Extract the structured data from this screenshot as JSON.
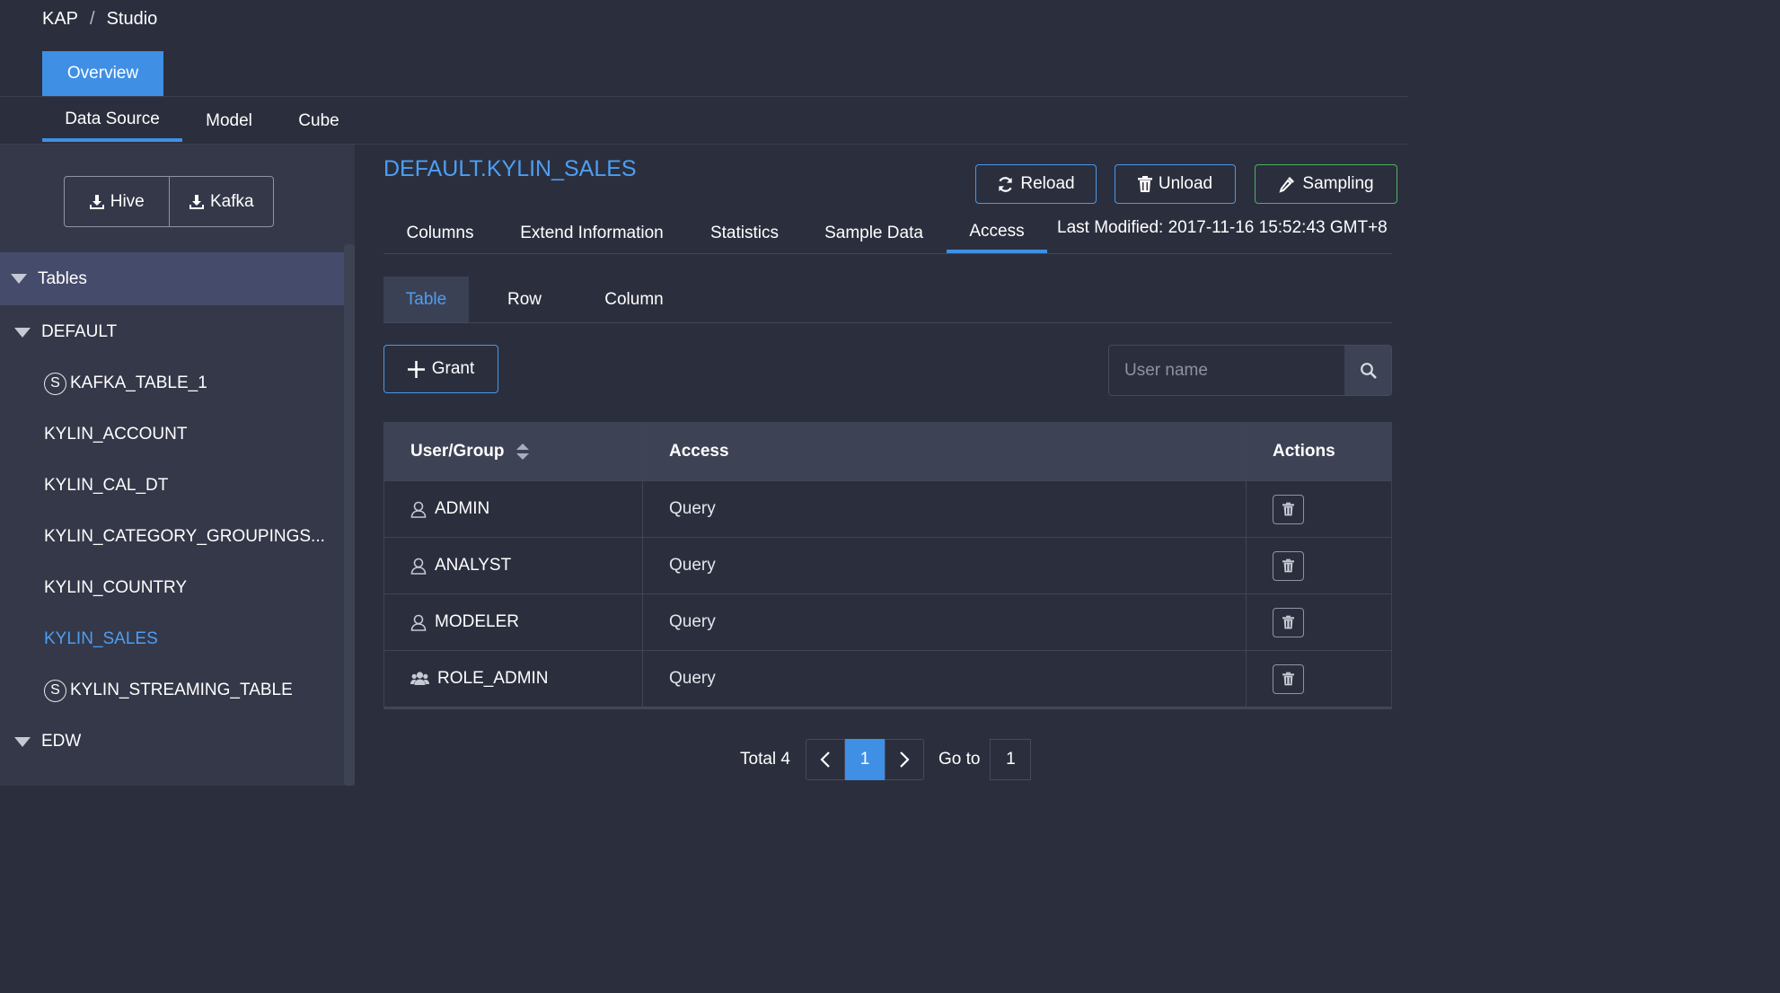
{
  "breadcrumb": {
    "root": "KAP",
    "separator": "/",
    "current": "Studio"
  },
  "overview_tab": "Overview",
  "subnav": {
    "items": [
      "Data Source",
      "Model",
      "Cube"
    ],
    "active": "Data Source"
  },
  "sidebar": {
    "import_buttons": {
      "hive": "Hive",
      "kafka": "Kafka"
    },
    "tables_header": "Tables",
    "databases": [
      {
        "name": "DEFAULT",
        "tables": [
          {
            "name": "KAFKA_TABLE_1",
            "streaming_badge": "S"
          },
          {
            "name": "KYLIN_ACCOUNT"
          },
          {
            "name": "KYLIN_CAL_DT"
          },
          {
            "name": "KYLIN_CATEGORY_GROUPINGS..."
          },
          {
            "name": "KYLIN_COUNTRY"
          },
          {
            "name": "KYLIN_SALES",
            "selected": true
          },
          {
            "name": "KYLIN_STREAMING_TABLE",
            "streaming_badge": "S"
          }
        ]
      },
      {
        "name": "EDW",
        "tables": []
      }
    ]
  },
  "main": {
    "table_title": "DEFAULT.KYLIN_SALES",
    "actions": {
      "reload": "Reload",
      "unload": "Unload",
      "sampling": "Sampling"
    },
    "tabs": [
      "Columns",
      "Extend Information",
      "Statistics",
      "Sample Data",
      "Access"
    ],
    "active_tab": "Access",
    "last_modified": "Last Modified: 2017-11-16 15:52:43 GMT+8",
    "access": {
      "tabs": [
        "Table",
        "Row",
        "Column"
      ],
      "active_tab": "Table",
      "grant_label": "Grant",
      "search_placeholder": "User name",
      "columns": {
        "user_group": "User/Group",
        "access": "Access",
        "actions": "Actions"
      },
      "rows": [
        {
          "name": "ADMIN",
          "type": "user",
          "access": "Query"
        },
        {
          "name": "ANALYST",
          "type": "user",
          "access": "Query"
        },
        {
          "name": "MODELER",
          "type": "user",
          "access": "Query"
        },
        {
          "name": "ROLE_ADMIN",
          "type": "group",
          "access": "Query"
        }
      ]
    },
    "pagination": {
      "total_label": "Total 4",
      "current_page": "1",
      "goto_label": "Go to",
      "goto_value": "1"
    }
  },
  "colors": {
    "accent": "#3f8fe5",
    "link": "#4d9ef2",
    "sampling_border": "#4fb061",
    "background": "#2b2f3d",
    "sidebar": "#343849"
  }
}
